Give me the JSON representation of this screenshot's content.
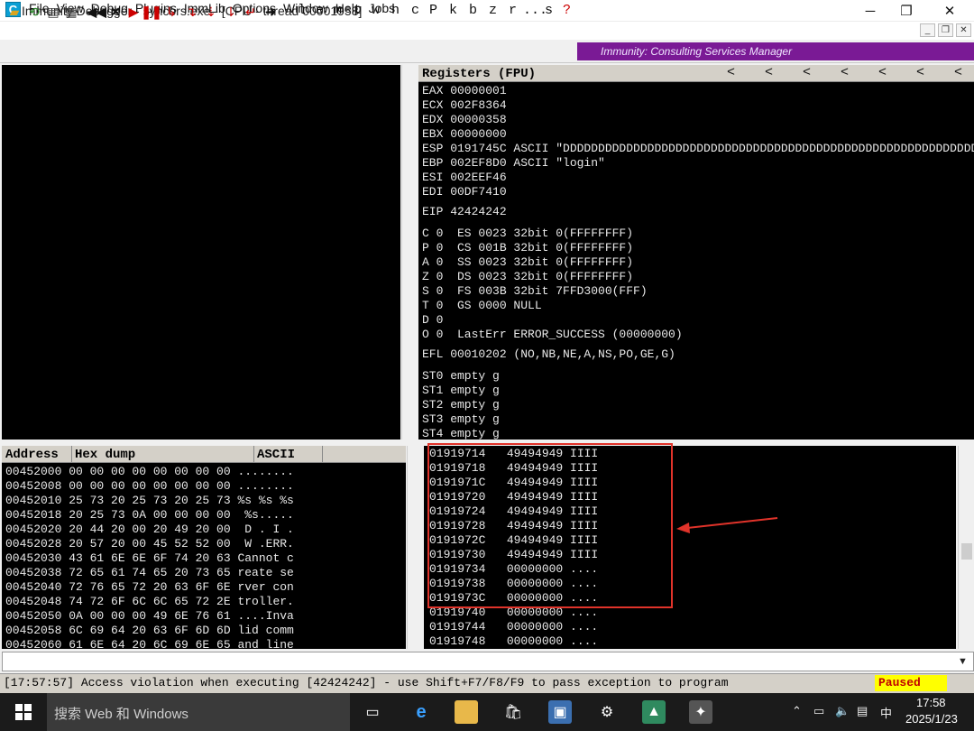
{
  "window": {
    "title": "Immunity Debugger - syncbrs.exe - [CPU - thread 00001958]",
    "minimize": "─",
    "maximize": "❐",
    "close": "✕"
  },
  "menu": {
    "app_icon_letter": "C",
    "items": [
      "File",
      "View",
      "Debug",
      "Plugins",
      "ImmLib",
      "Options",
      "Window",
      "Help",
      "Jobs"
    ],
    "mdi_min": "_",
    "mdi_restore": "❐",
    "mdi_close": "✕"
  },
  "toolbar": {
    "letters": [
      "l",
      "e",
      "m",
      "t",
      "w",
      "h",
      "c",
      "P",
      "k",
      "b",
      "z",
      "r",
      "...",
      "s",
      "?"
    ],
    "banner": "Immunity: Consulting Services Manager"
  },
  "registers": {
    "header": "Registers (FPU)",
    "arrows": [
      "<",
      "<",
      "<",
      "<",
      "<",
      "<",
      "<"
    ],
    "lines": [
      "EAX 00000001",
      "ECX 002F8364",
      "EDX 00000358",
      "EBX 00000000",
      "ESP 0191745C ASCII \"DDDDDDDDDDDDDDDDDDDDDDDDDDDDDDDDDDDDDDDDDDDDDDDDDDDDDDDDDDDDDDDD",
      "EBP 002EF8D0 ASCII \"login\"",
      "ESI 002EEF46",
      "EDI 00DF7410",
      "",
      "EIP 42424242",
      "",
      "C 0  ES 0023 32bit 0(FFFFFFFF)",
      "P 0  CS 001B 32bit 0(FFFFFFFF)",
      "A 0  SS 0023 32bit 0(FFFFFFFF)",
      "Z 0  DS 0023 32bit 0(FFFFFFFF)",
      "S 0  FS 003B 32bit 7FFD3000(FFF)",
      "T 0  GS 0000 NULL",
      "D 0",
      "O 0  LastErr ERROR_SUCCESS (00000000)",
      "",
      "EFL 00010202 (NO,NB,NE,A,NS,PO,GE,G)",
      "",
      "ST0 empty g",
      "ST1 empty g",
      "ST2 empty g",
      "ST3 empty g",
      "ST4 empty g"
    ]
  },
  "dump": {
    "col_address": "Address",
    "col_hex": "Hex dump",
    "col_ascii": "ASCII",
    "lines": [
      "00452000 00 00 00 00 00 00 00 00 ........",
      "00452008 00 00 00 00 00 00 00 00 ........",
      "00452010 25 73 20 25 73 20 25 73 %s %s %s",
      "00452018 20 25 73 0A 00 00 00 00  %s.....",
      "00452020 20 44 20 00 20 49 20 00  D . I .",
      "00452028 20 57 20 00 45 52 52 00  W .ERR.",
      "00452030 43 61 6E 6E 6F 74 20 63 Cannot c",
      "00452038 72 65 61 74 65 20 73 65 reate se",
      "00452040 72 76 65 72 20 63 6F 6E rver con",
      "00452048 74 72 6F 6C 6C 65 72 2E troller.",
      "00452050 0A 00 00 00 49 6E 76 61 ....Inva",
      "00452058 6C 69 64 20 63 6F 6D 6D lid comm",
      "00452060 61 6E 64 20 6C 69 6E 65 and line"
    ]
  },
  "stack": {
    "lines": [
      "01919714   49494949 IIII",
      "01919718   49494949 IIII",
      "0191971C   49494949 IIII",
      "01919720   49494949 IIII",
      "01919724   49494949 IIII",
      "01919728   49494949 IIII",
      "0191972C   49494949 IIII",
      "01919730   49494949 IIII",
      "01919734   00000000 ....",
      "01919738   00000000 ....",
      "0191973C   00000000 ....",
      "01919740   00000000 ....",
      "01919744   00000000 ....",
      "01919748   00000000 ...."
    ]
  },
  "status": {
    "message": "[17:57:57] Access violation when executing [42424242] - use Shift+F7/F8/F9 to pass exception to program",
    "state": "Paused"
  },
  "taskbar": {
    "search_placeholder": "搜索 Web 和 Windows",
    "time": "17:58",
    "date": "2025/1/23",
    "ime": "中"
  },
  "colors": {
    "highlight_box": "#e0332a",
    "banner_bg": "#7a1a95",
    "paused_bg": "#ffff00"
  }
}
